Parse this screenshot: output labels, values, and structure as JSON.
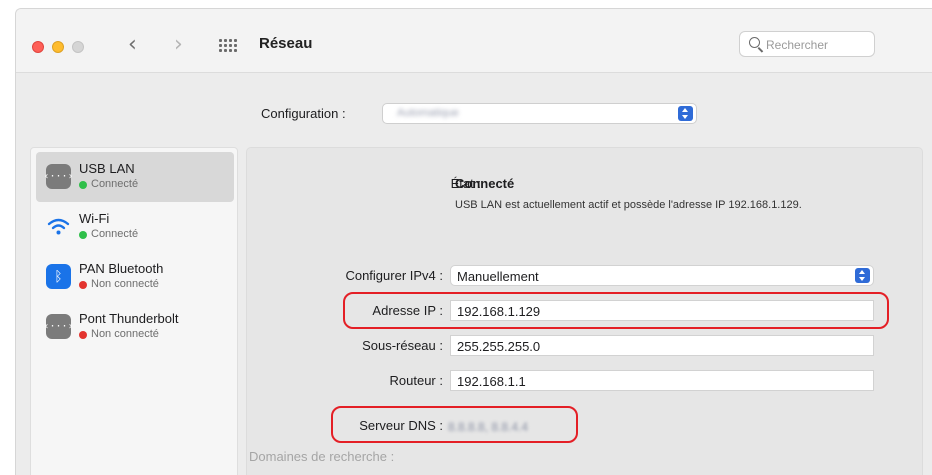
{
  "window": {
    "title": "Réseau",
    "search_placeholder": "Rechercher"
  },
  "toolbar": {
    "back_glyph": "‹",
    "forward_glyph": "›"
  },
  "configuration": {
    "label": "Configuration :",
    "value": "Automatique"
  },
  "sidebar": {
    "items": [
      {
        "name": "USB LAN",
        "status": "Connecté",
        "status_color": "#2fbf4a",
        "icon": "ethernet-icon",
        "icon_glyph": "‹···›",
        "selected": true
      },
      {
        "name": "Wi-Fi",
        "status": "Connecté",
        "status_color": "#2fbf4a",
        "icon": "wifi-icon",
        "selected": false
      },
      {
        "name": "PAN Bluetooth",
        "status": "Non connecté",
        "status_color": "#e3342f",
        "icon": "bluetooth-icon",
        "icon_glyph": "ᛒ",
        "selected": false
      },
      {
        "name": "Pont Thunderbolt",
        "status": "Non connecté",
        "status_color": "#e3342f",
        "icon": "thunderbolt-bridge-icon",
        "icon_glyph": "‹···›",
        "selected": false
      }
    ]
  },
  "detail": {
    "etat_label": "État :",
    "etat_value": "Connecté",
    "etat_description": "USB LAN est actuellement actif et possède l'adresse IP 192.168.1.129.",
    "ipv4_label": "Configurer IPv4 :",
    "ipv4_value": "Manuellement",
    "ip_label": "Adresse IP :",
    "ip_value": "192.168.1.129",
    "subnet_label": "Sous-réseau :",
    "subnet_value": "255.255.255.0",
    "router_label": "Routeur :",
    "router_value": "192.168.1.1",
    "dns_label": "Serveur DNS :",
    "dns_value": "8.8.8.8, 8.8.4.4",
    "search_domains_label": "Domaines de recherche :"
  },
  "colors": {
    "accent": "#2f6bd7",
    "highlight": "#e41f26"
  }
}
